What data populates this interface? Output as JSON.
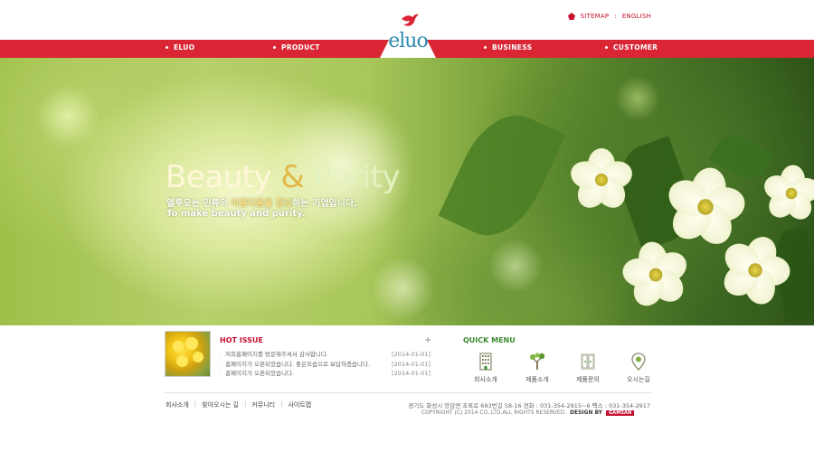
{
  "brand": {
    "logo_text": "eluo"
  },
  "util_links": {
    "sitemap": "SITEMAP",
    "sep": ":",
    "english": "ENGLISH"
  },
  "nav": {
    "items": [
      {
        "label": "ELUO"
      },
      {
        "label": "PRODUCT"
      },
      {
        "label": "BUSINESS"
      },
      {
        "label": "CUSTOMER"
      }
    ]
  },
  "hero": {
    "headline_word1": "Beauty",
    "headline_amp": "&",
    "headline_word2": "Purity",
    "sub_ko_prefix": "엘루오는 인류의",
    "sub_ko_highlight": "아름다움을 창조",
    "sub_ko_suffix": "하는 기업입니다.",
    "sub_en": "To make beauty and purity."
  },
  "hot_issue": {
    "title": "HOT ISSUE",
    "more": "+",
    "items": [
      {
        "text": "저희홈페이지를 방문해주셔서 감사합니다.",
        "date": "[2014-01-01]"
      },
      {
        "text": "홈페이지가 오픈되었습니다. 좋은모습으로 보답하겠습니다.",
        "date": "[2014-01-01]"
      },
      {
        "text": "홈페이지가 오픈되었습니다.",
        "date": "[2014-01-01]"
      }
    ]
  },
  "quick_menu": {
    "title": "QUICK MENU",
    "items": [
      {
        "label": "회사소개",
        "icon": "building-icon"
      },
      {
        "label": "제품소개",
        "icon": "tree-icon"
      },
      {
        "label": "제품문의",
        "icon": "door-icon"
      },
      {
        "label": "오시는길",
        "icon": "location-pin-icon"
      }
    ]
  },
  "footer": {
    "links": [
      "회사소개",
      "찾아오시는 길",
      "커뮤니티",
      "사이트맵"
    ],
    "link_sep": "|",
    "address": "경기도 화성시 양감면 초록로 693번길 58-16  전화 : 031-354-2915~6  팩스 : 031-354-2917",
    "copyright": "COPYRIGHT (C) 2014 CO.,LTD.ALL RIGHTS RESERVED.",
    "design_by": "DESIGN BY",
    "design_badge": "GAMSAN"
  },
  "colors": {
    "brand_red": "#d92534",
    "logo_blue": "#2e8bb0",
    "quick_green": "#3b8a2e"
  }
}
